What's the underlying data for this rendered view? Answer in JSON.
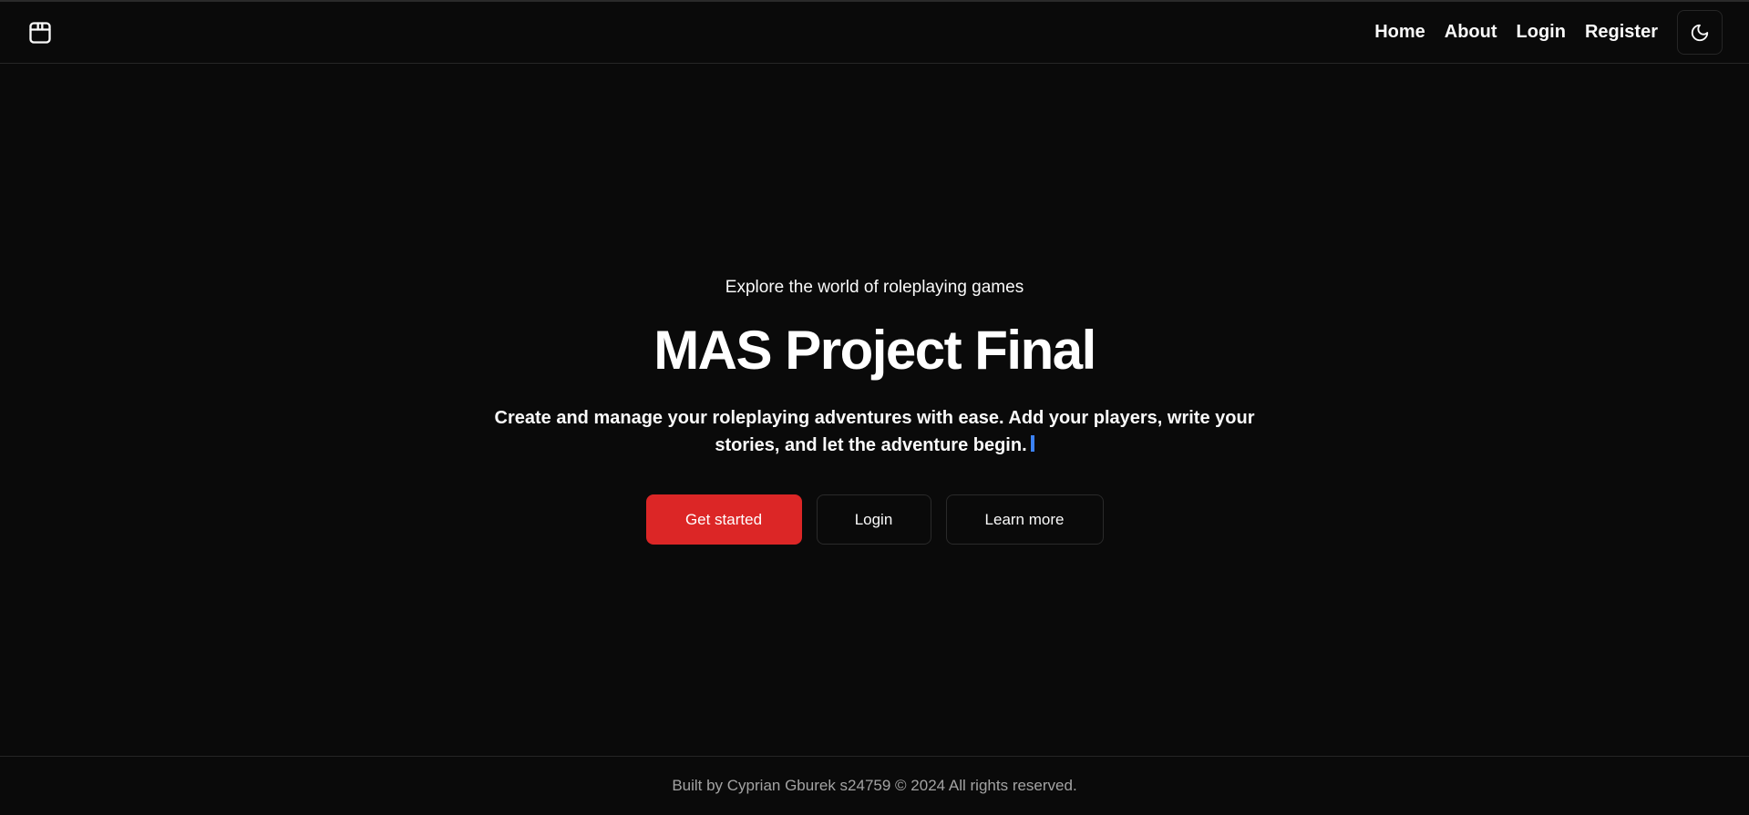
{
  "header": {
    "logo_icon": "package-icon",
    "nav": [
      {
        "label": "Home"
      },
      {
        "label": "About"
      },
      {
        "label": "Login"
      },
      {
        "label": "Register"
      }
    ],
    "theme_toggle_icon": "moon-icon"
  },
  "hero": {
    "eyebrow": "Explore the world of roleplaying games",
    "title": "MAS Project Final",
    "description": "Create and manage your roleplaying adventures with ease. Add your players, write your stories, and let the adventure begin.",
    "buttons": {
      "primary": "Get started",
      "login": "Login",
      "learn_more": "Learn more"
    }
  },
  "footer": {
    "text": "Built by Cyprian Gburek s24759 © 2024 All rights reserved."
  },
  "colors": {
    "background": "#0a0a0a",
    "accent": "#dc2626",
    "border": "#262626",
    "muted_text": "#a3a3a3",
    "caret": "#3b82f6"
  }
}
